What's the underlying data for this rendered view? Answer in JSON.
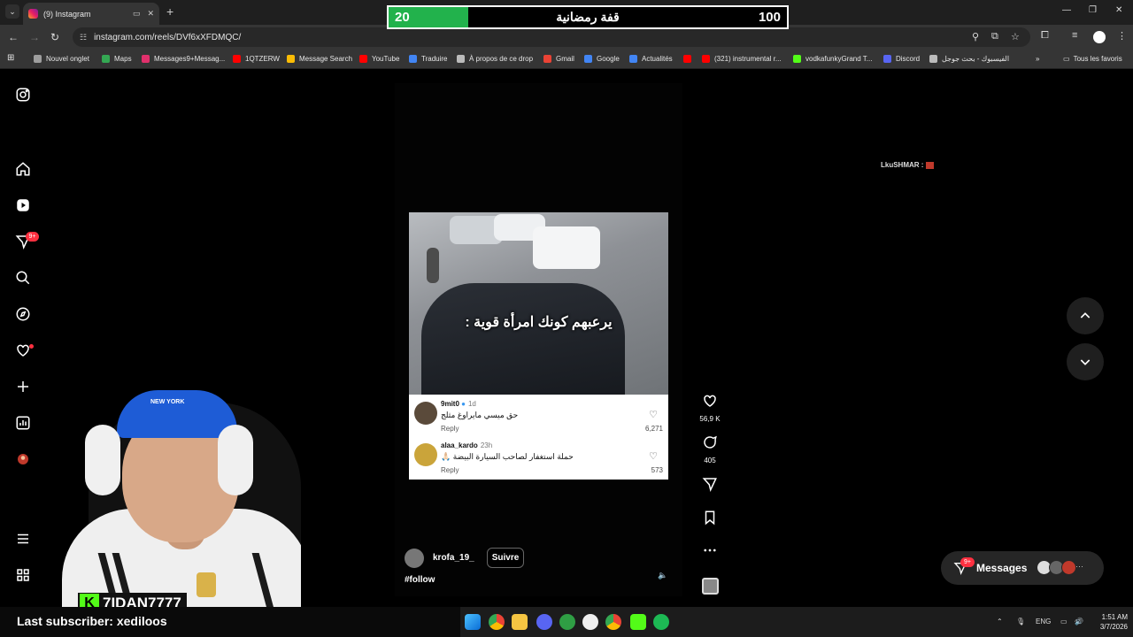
{
  "browser": {
    "tab_title": "(9) Instagram",
    "url": "instagram.com/reels/DVf6xXFDMQC/",
    "bookmarks": [
      {
        "label": "Nouvel onglet",
        "color": "#9e9e9e"
      },
      {
        "label": "Maps",
        "color": "#34a853"
      },
      {
        "label": "Messages9+Messag...",
        "color": "#e1306c"
      },
      {
        "label": "1QTZERW",
        "color": "#ff0000"
      },
      {
        "label": "Message Search",
        "color": "#fbbc05"
      },
      {
        "label": "YouTube",
        "color": "#ff0000"
      },
      {
        "label": "Traduire",
        "color": "#4285f4"
      },
      {
        "label": "À propos de ce drop",
        "color": "#bbbbbb"
      },
      {
        "label": "Gmail",
        "color": "#ea4335"
      },
      {
        "label": "Google",
        "color": "#4285f4"
      },
      {
        "label": "Actualités",
        "color": "#4285f4"
      },
      {
        "label": "",
        "color": "#ff0000"
      },
      {
        "label": "(321) instrumental r...",
        "color": "#ff0000"
      },
      {
        "label": "vodkafunkyGrand T...",
        "color": "#53fc18"
      },
      {
        "label": "Discord",
        "color": "#5865f2"
      },
      {
        "label": "الفيسبوك - بحث جوجل",
        "color": "#bbbbbb"
      }
    ],
    "all_bookmarks": "Tous les favoris"
  },
  "overlay": {
    "left_score": "20",
    "title": "قفة رمضانية",
    "right_score": "100",
    "progress_fraction": 0.2
  },
  "sidebar": {
    "notifications_badge": "9+"
  },
  "reel": {
    "caption_overlay": "يرعبهم كونك امرأة قوية :",
    "comments": [
      {
        "user": "9mit0",
        "ago": "1d",
        "text": "حق ميسي مايراوغ مثلج",
        "reply": "Reply",
        "likes": "6,271"
      },
      {
        "user": "alaa_kardo",
        "ago": "23h",
        "text": "حملة استغفار لصاحب السيارة البيضة 🙏🏻",
        "reply": "Reply",
        "likes": "573"
      }
    ],
    "account": "krofa_19_",
    "follow_label": "Suivre",
    "hashtag": "#follow",
    "likes_count": "56,9 K",
    "comments_count": "405"
  },
  "side_label": "LkuSHMAR :",
  "messages": {
    "label": "Messages",
    "badge": "9+"
  },
  "stream": {
    "kick_name": "7IDAN7777",
    "last_subscriber": "Last subscriber: xediloos",
    "cap_text": "NEW YORK"
  },
  "system": {
    "language": "ENG",
    "time": "1:51 AM",
    "date": "3/7/2026"
  }
}
